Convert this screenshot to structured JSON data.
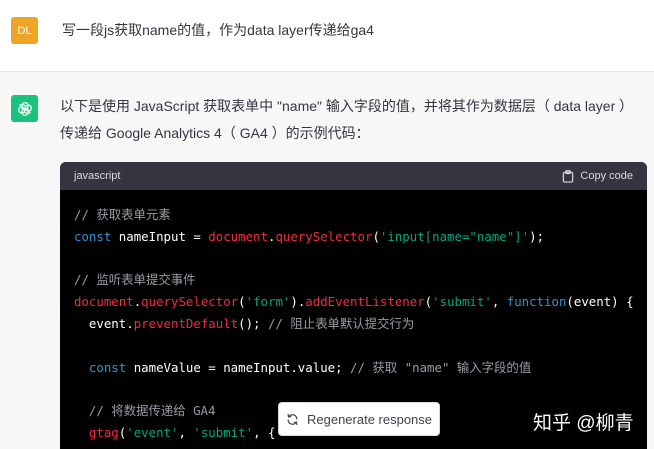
{
  "user": {
    "avatar_text": "DL",
    "message": "写一段js获取name的值，作为data layer传递给ga4"
  },
  "assistant": {
    "line1": "以下是使用 JavaScript 获取表单中 \"name\" 输入字段的值，并将其作为数据层（ data layer ）",
    "line2": "传递给 Google Analytics 4（ GA4 ）的示例代码："
  },
  "code": {
    "language": "javascript",
    "copy_label": "Copy code",
    "comment1": "// 获取表单元素",
    "l2_kw": "const",
    "l2_var": " nameInput = ",
    "l2_obj": "document",
    "l2_dot": ".",
    "l2_fn": "querySelector",
    "l2_open": "(",
    "l2_str": "'input[name=\"name\"]'",
    "l2_close": ");",
    "comment2": "// 监听表单提交事件",
    "l4_obj": "document",
    "l4_dot1": ".",
    "l4_fn1": "querySelector",
    "l4_open1": "(",
    "l4_str1": "'form'",
    "l4_close1": ").",
    "l4_fn2": "addEventListener",
    "l4_open2": "(",
    "l4_str2": "'submit'",
    "l4_comma": ", ",
    "l4_kw": "function",
    "l4_tail": "(event) {",
    "l5_indent": "  event.",
    "l5_fn": "preventDefault",
    "l5_tail": "(); ",
    "l5_cm": "// 阻止表单默认提交行为",
    "l7_indent": "  ",
    "l7_kw": "const",
    "l7_mid": " nameValue = nameInput.value; ",
    "l7_cm": "// 获取 \"name\" 输入字段的值",
    "l9_cm": "  // 将数据传递给 GA4",
    "l10_indent": "  ",
    "l10_fn": "gtag",
    "l10_open": "(",
    "l10_str1": "'event'",
    "l10_comma": ", ",
    "l10_str2": "'submit'",
    "l10_tail": ", {"
  },
  "regenerate_label": "Regenerate response",
  "watermark": "知乎 @柳青"
}
